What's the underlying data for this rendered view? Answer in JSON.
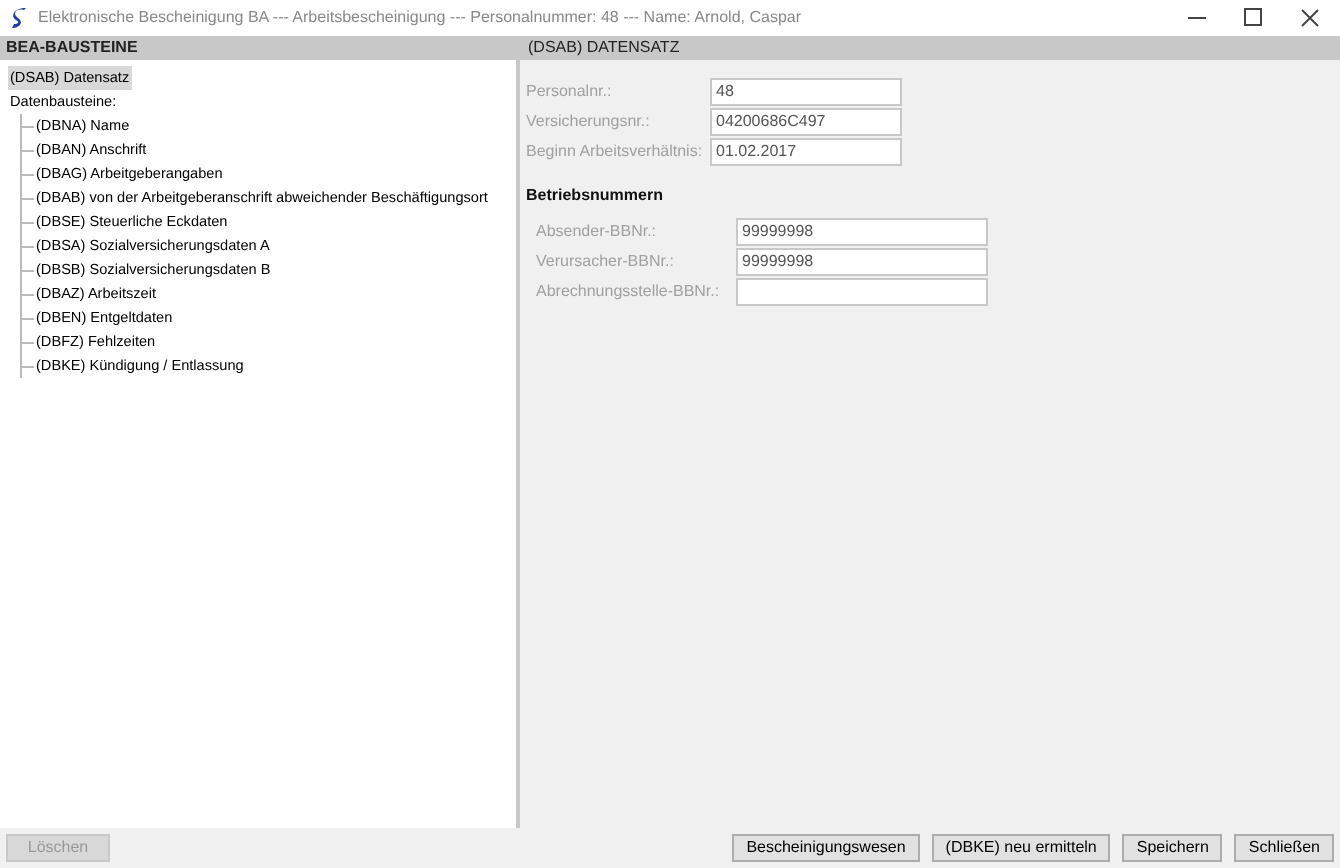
{
  "window": {
    "title": "Elektronische Bescheinigung BA --- Arbeitsbescheinigung --- Personalnummer: 48 --- Name: Arnold, Caspar"
  },
  "left_panel": {
    "header": "BEA-BAUSTEINE",
    "tree": [
      {
        "label": "(DSAB) Datensatz",
        "selected": true
      },
      {
        "label": "Datenbausteine:",
        "selected": false,
        "children": [
          {
            "label": "(DBNA) Name",
            "selected": false
          },
          {
            "label": "(DBAN) Anschrift",
            "selected": false
          },
          {
            "label": "(DBAG) Arbeitgeberangaben",
            "selected": false
          },
          {
            "label": "(DBAB) von der Arbeitgeberanschrift abweichender Beschäftigungsort",
            "selected": false
          },
          {
            "label": "(DBSE) Steuerliche Eckdaten",
            "selected": false
          },
          {
            "label": "(DBSA) Sozialversicherungsdaten A",
            "selected": false
          },
          {
            "label": "(DBSB) Sozialversicherungsdaten B",
            "selected": false
          },
          {
            "label": "(DBAZ) Arbeitszeit",
            "selected": false
          },
          {
            "label": "(DBEN) Entgeltdaten",
            "selected": false
          },
          {
            "label": "(DBFZ) Fehlzeiten",
            "selected": false
          },
          {
            "label": "(DBKE) Kündigung / Entlassung",
            "selected": false
          }
        ]
      }
    ]
  },
  "right_panel": {
    "header": "(DSAB) DATENSATZ",
    "fields": [
      {
        "label": "Personalnr.:",
        "value": "48",
        "disabled": true
      },
      {
        "label": "Versicherungsnr.:",
        "value": "04200686C497",
        "disabled": true
      },
      {
        "label": "Beginn Arbeitsverhältnis:",
        "value": "01.02.2017",
        "disabled": true
      }
    ],
    "section_title": "Betriebsnummern",
    "bbnr_fields": [
      {
        "label": "Absender-BBNr.:",
        "value": "99999998",
        "disabled": true
      },
      {
        "label": "Verursacher-BBNr.:",
        "value": "99999998",
        "disabled": true
      },
      {
        "label": "Abrechnungsstelle-BBNr.:",
        "disabled": true
      }
    ]
  },
  "buttons": [
    {
      "label": "Löschen",
      "disabled": true
    },
    {
      "label": "Bescheinigungswesen",
      "disabled": false
    },
    {
      "label": "(DBKE) neu ermitteln",
      "disabled": false
    },
    {
      "label": "Speichern",
      "disabled": false
    },
    {
      "label": "Schließen",
      "disabled": false
    }
  ]
}
